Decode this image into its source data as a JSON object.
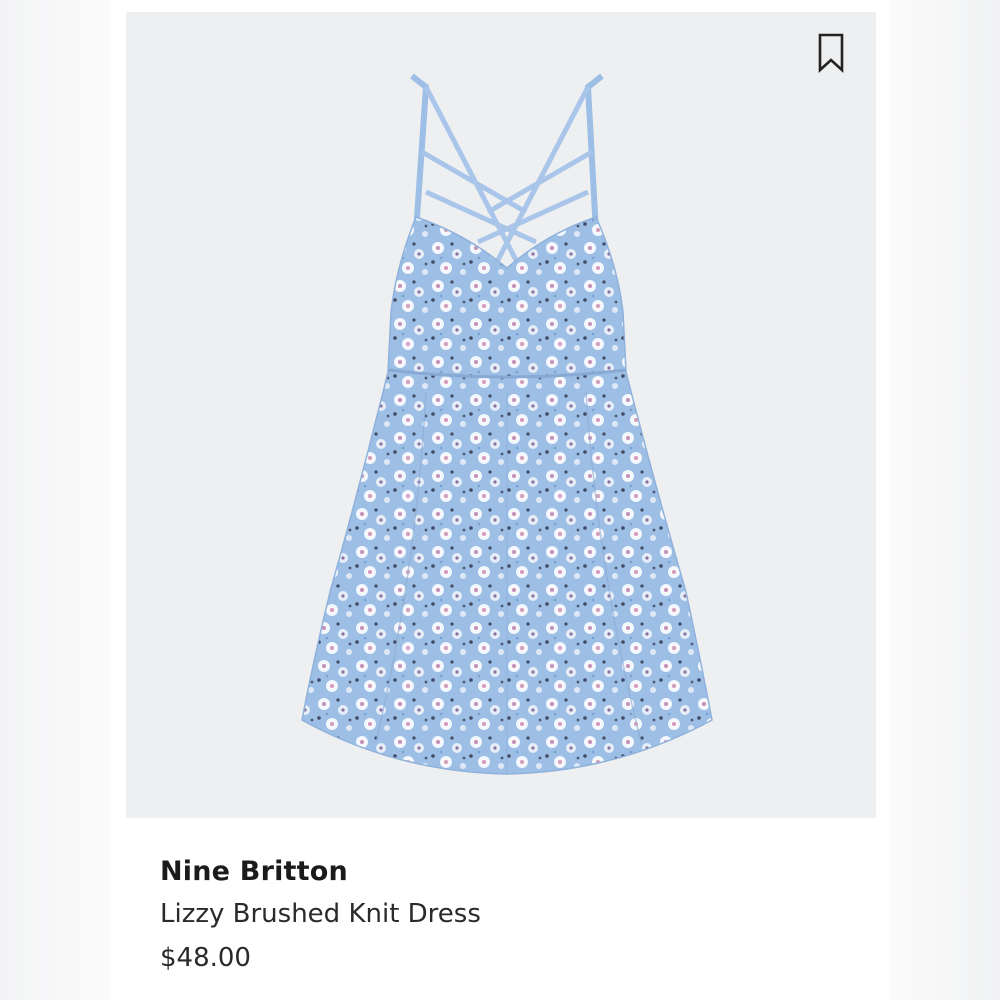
{
  "product": {
    "brand": "Nine Britton",
    "name": "Lizzy Brushed Knit Dress",
    "price": "$48.00",
    "image_alt": "Blue floral print sleeveless strappy dress",
    "image_icon": "dress-image",
    "bookmark_icon": "bookmark-icon"
  },
  "colors": {
    "image_background": "#eeeff1",
    "dress_base": "#9dbfe6",
    "dress_flower": "#f4f7fb",
    "dress_dot": "#5b6b86",
    "text": "#1b1b1b"
  }
}
